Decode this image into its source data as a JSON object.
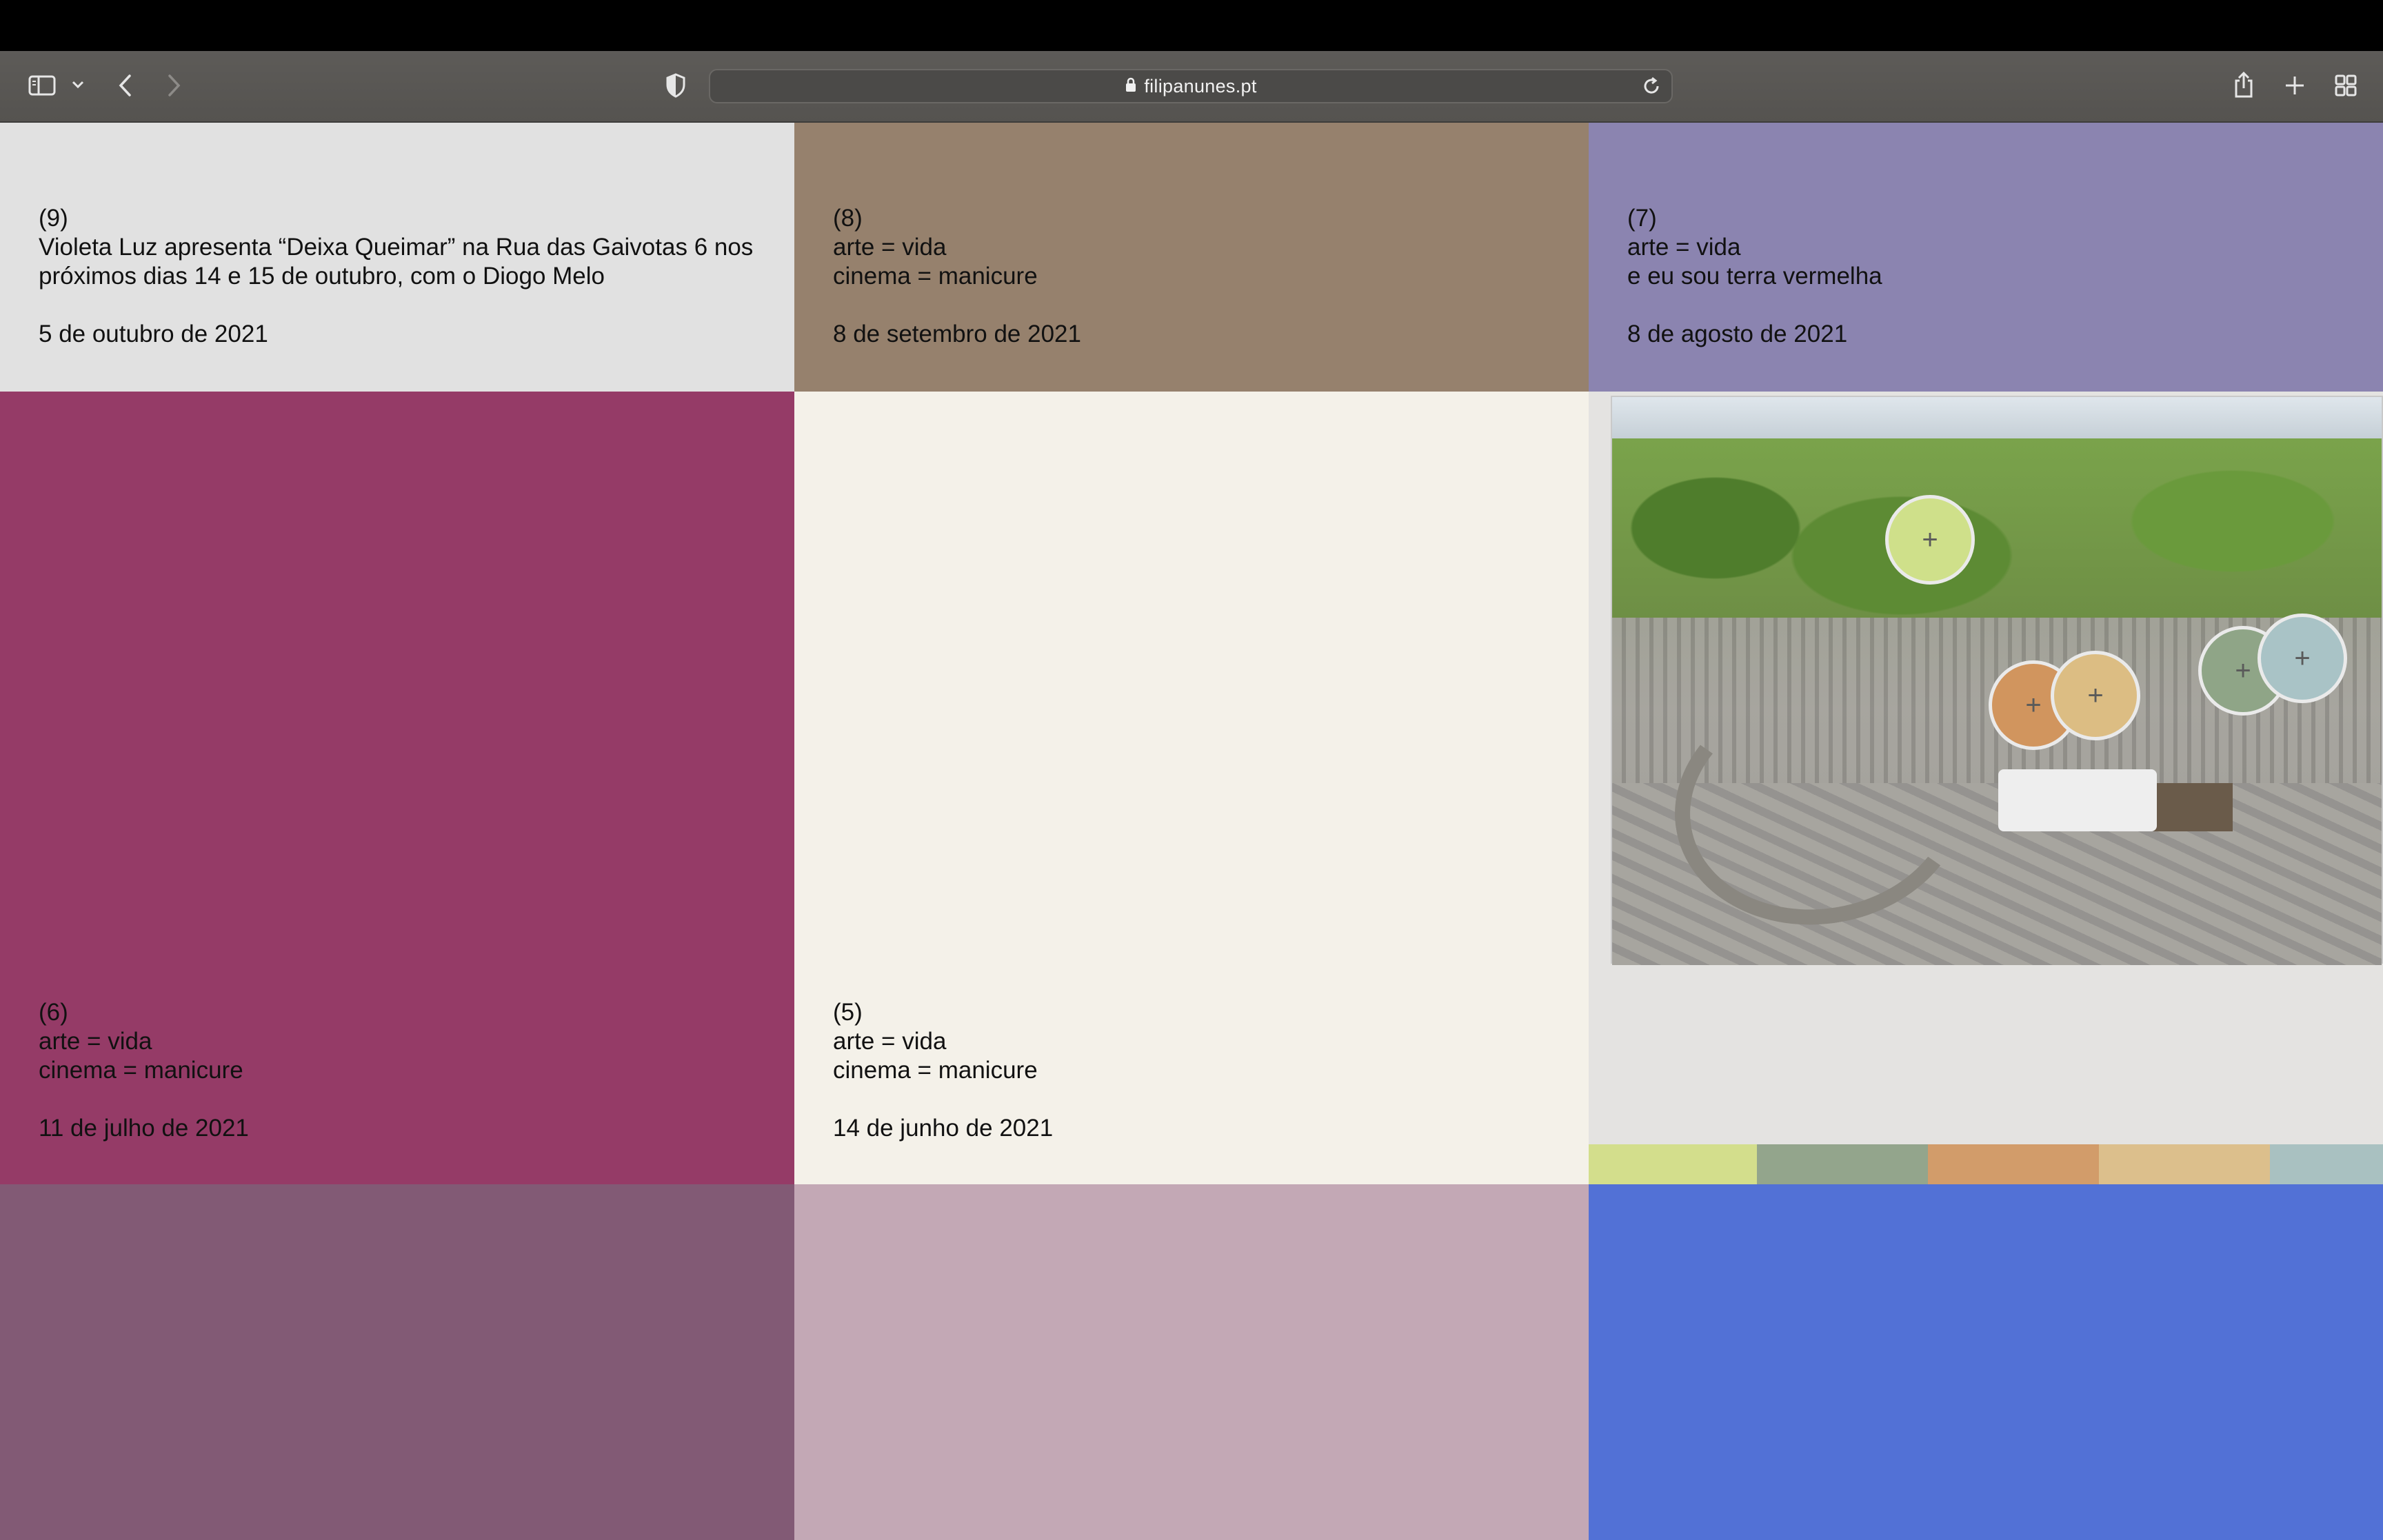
{
  "browser": {
    "url": "filipanunes.pt",
    "icons": [
      "sidebar-icon",
      "chevron-down-icon",
      "back-icon",
      "forward-icon",
      "shield-icon",
      "lock-icon",
      "reload-icon",
      "share-icon",
      "new-tab-icon",
      "tab-overview-icon"
    ]
  },
  "posts": [
    {
      "number": "(9)",
      "lines": [
        "Violeta Luz apresenta “Deixa Queimar” na Rua das Gaivotas 6 nos",
        "próximos dias 14 e 15 de outubro, com o Diogo Melo"
      ],
      "date": "5 de outubro de 2021",
      "color": "#e1e1e1"
    },
    {
      "number": "(8)",
      "lines": [
        "arte = vida",
        "cinema = manicure"
      ],
      "date": "8 de setembro de 2021",
      "color": "#96816d"
    },
    {
      "number": "(7)",
      "lines": [
        "arte = vida",
        "e eu sou terra vermelha"
      ],
      "date": "8 de agosto de 2021",
      "color": "#8b84b0"
    },
    {
      "number": "(6)",
      "lines": [
        "arte = vida",
        "cinema = manicure"
      ],
      "date": "11 de julho de 2021",
      "color": "#953b67"
    },
    {
      "number": "(5)",
      "lines": [
        "arte = vida",
        "cinema = manicure"
      ],
      "date": "14 de junho de 2021",
      "color": "#f4f1e9"
    }
  ],
  "palette_card": {
    "markers": [
      {
        "symbol": "+",
        "color": "#cfe08a"
      },
      {
        "symbol": "+",
        "color": "#d1955e"
      },
      {
        "symbol": "+",
        "color": "#dcbd83"
      },
      {
        "symbol": "+",
        "color": "#8fa587"
      },
      {
        "symbol": "+",
        "color": "#a9c3c6"
      }
    ],
    "swatches": [
      "#d3de8c",
      "#93a58c",
      "#d29c6a",
      "#dcbf8c",
      "#a9c1c1"
    ]
  },
  "tiles": {
    "bottom_left": "#825a75",
    "bottom_middle": "#c3a8b5",
    "bottom_right": "#5271d6"
  }
}
